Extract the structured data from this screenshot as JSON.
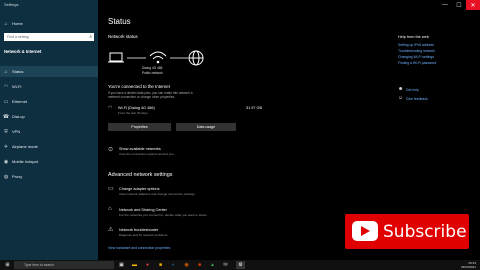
{
  "window": {
    "title": "Settings",
    "min": "—",
    "max": "☐",
    "close": "✕"
  },
  "sidebar": {
    "home": "Home",
    "search_placeholder": "Find a setting",
    "section": "Network & Internet",
    "items": [
      {
        "label": "Status",
        "icon": "home-icon"
      },
      {
        "label": "Wi-Fi",
        "icon": "wifi-icon"
      },
      {
        "label": "Ethernet",
        "icon": "ethernet-icon"
      },
      {
        "label": "Dial-up",
        "icon": "dialup-icon"
      },
      {
        "label": "VPN",
        "icon": "vpn-icon"
      },
      {
        "label": "Airplane mode",
        "icon": "airplane-icon"
      },
      {
        "label": "Mobile hotspot",
        "icon": "hotspot-icon"
      },
      {
        "label": "Proxy",
        "icon": "globe-icon"
      }
    ]
  },
  "main": {
    "title": "Status",
    "network_status": "Network status",
    "network_name": "Dialog 4G 486",
    "network_type": "Public network",
    "connected_heading": "You're connected to the Internet",
    "connected_desc1": "If you have a limited data plan, you can make this network a",
    "connected_desc2": "metered connection or change other properties.",
    "adapter_name": "Wi-Fi (Dialog 4G 486)",
    "adapter_sub": "From the last 30 days",
    "adapter_usage": "31.97 GB",
    "properties": "Properties",
    "data_usage": "Data usage",
    "show_networks": "Show available networks",
    "show_networks_desc": "View the connection options around you.",
    "advanced_heading": "Advanced network settings",
    "adv": [
      {
        "title": "Change adapter options",
        "desc": "View network adapters and change connection settings."
      },
      {
        "title": "Network and Sharing Center",
        "desc": "For the networks you connect to, decide what you want to share."
      },
      {
        "title": "Network troubleshooter",
        "desc": "Diagnose and fix network problems."
      }
    ],
    "view_hw": "View hardware and connection properties"
  },
  "right": {
    "help_title": "Help from the web",
    "links": [
      "Setting up IPv6 address",
      "Troubleshooting network",
      "Changing Wi-Fi settings",
      "Finding a Wi-Fi password"
    ],
    "get_help": "Get help",
    "feedback": "Give feedback"
  },
  "overlay": {
    "subscribe": "Subscribe"
  },
  "taskbar": {
    "search": "Type here to search",
    "time": "09:43",
    "date": "29/03/2021"
  }
}
